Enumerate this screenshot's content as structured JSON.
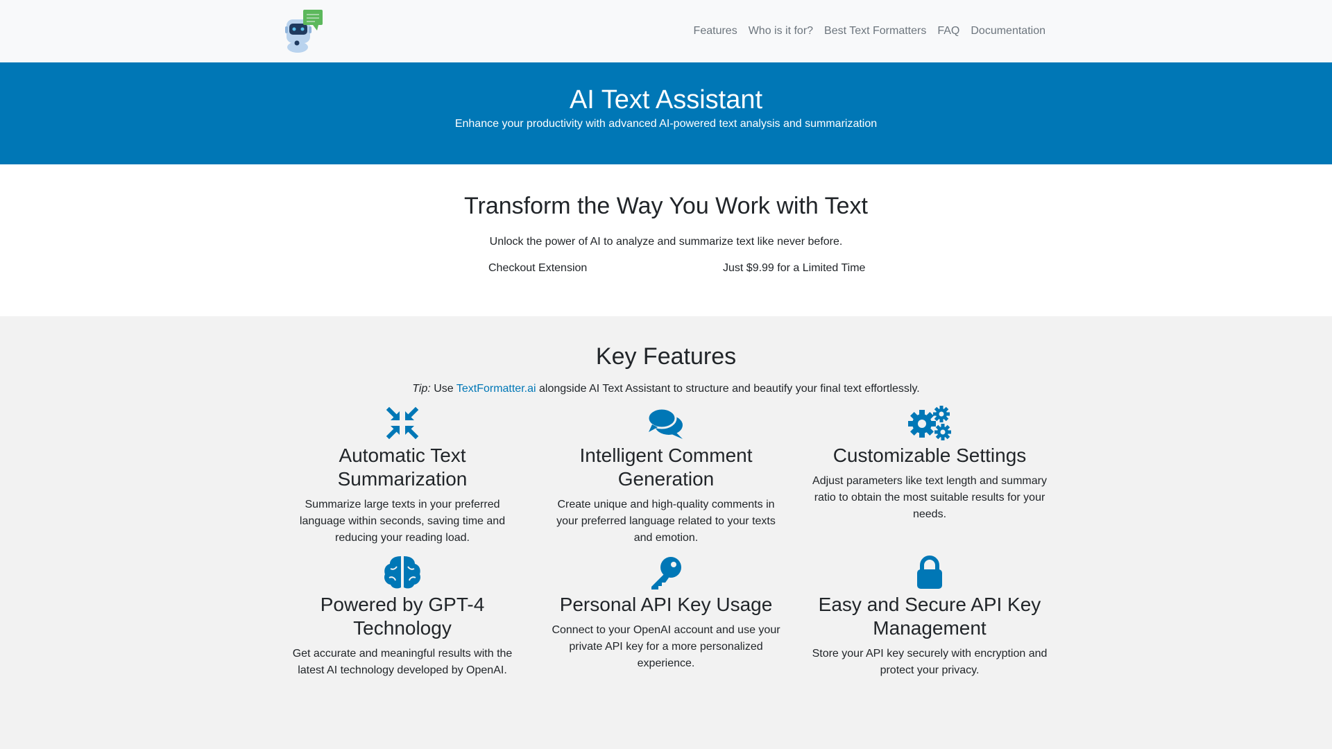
{
  "brand": {
    "logo_icon": "robot-chat-icon",
    "accent": "#0077b6",
    "logo_bubble": "#5cb85c"
  },
  "nav": {
    "links": [
      "Features",
      "Who is it for?",
      "Best Text Formatters",
      "FAQ",
      "Documentation"
    ]
  },
  "hero": {
    "title": "AI Text Assistant",
    "subtitle": "Enhance your productivity with advanced AI-powered text analysis and summarization"
  },
  "intro": {
    "title": "Transform the Way You Work with Text",
    "lead": "Unlock the power of AI to analyze and summarize text like never before.",
    "checkout": "Checkout Extension",
    "price": "Just $9.99 for a Limited Time"
  },
  "features": {
    "title": "Key Features",
    "tip": {
      "label": "Tip:",
      "pre": "Use",
      "link": "TextFormatter.ai",
      "post": "alongside AI Text Assistant to structure and beautify your final text effortlessly."
    },
    "items": [
      {
        "icon": "compress-arrows-icon",
        "title": "Automatic Text Summarization",
        "desc": "Summarize large texts in your preferred language within seconds, saving time and reducing your reading load."
      },
      {
        "icon": "comments-icon",
        "title": "Intelligent Comment Generation",
        "desc": "Create unique and high-quality comments in your preferred language related to your texts and emotion."
      },
      {
        "icon": "gears-icon",
        "title": "Customizable Settings",
        "desc": "Adjust parameters like text length and summary ratio to obtain the most suitable results for your needs."
      },
      {
        "icon": "brain-icon",
        "title": "Powered by GPT-4 Technology",
        "desc": "Get accurate and meaningful results with the latest AI technology developed by OpenAI."
      },
      {
        "icon": "key-icon",
        "title": "Personal API Key Usage",
        "desc": "Connect to your OpenAI account and use your private API key for a more personalized experience."
      },
      {
        "icon": "lock-icon",
        "title": "Easy and Secure API Key Management",
        "desc": "Store your API key securely with encryption and protect your privacy."
      }
    ]
  }
}
